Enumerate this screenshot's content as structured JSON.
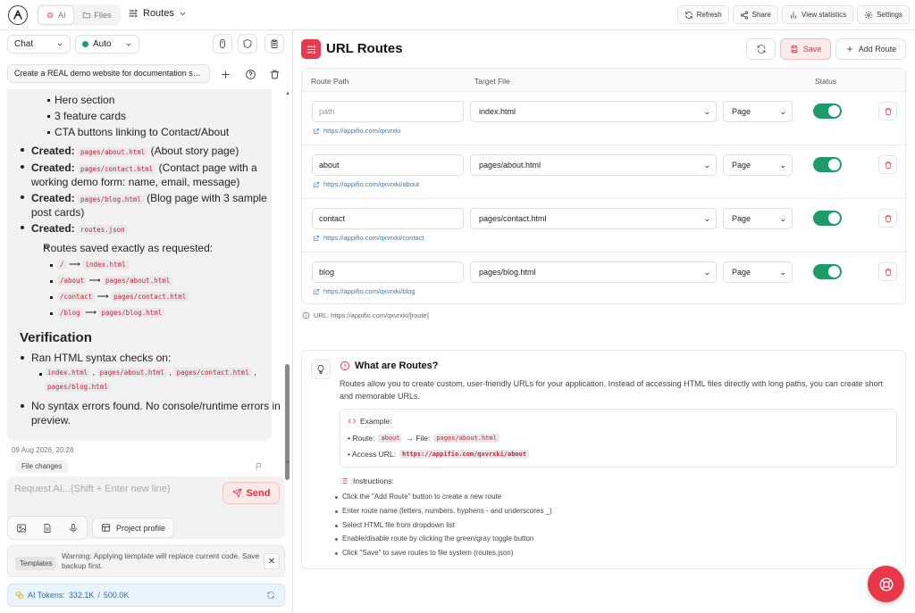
{
  "topbar": {
    "tabs": [
      {
        "label": "AI",
        "icon": "sparkle-icon"
      },
      {
        "label": "Files",
        "icon": "folder-icon"
      }
    ],
    "current": "Routes",
    "actions": [
      {
        "label": "Refresh"
      },
      {
        "label": "Share"
      },
      {
        "label": "View statistics"
      },
      {
        "label": "Settings"
      }
    ]
  },
  "sidebar": {
    "mode": "Chat",
    "model": "Auto",
    "model_status_color": "#1e9b6a",
    "conversation_title": "Create a REAL demo website for documentation sc...",
    "chat": {
      "hero_items": [
        "Hero section",
        "3 feature cards",
        "CTA buttons linking to Contact/About"
      ],
      "created": [
        {
          "label": "Created:",
          "file": "pages/about.html",
          "desc": "(About story page)"
        },
        {
          "label": "Created:",
          "file": "pages/contact.html",
          "desc": "(Contact page with a",
          "desc2": "working demo form: name, email, message)"
        },
        {
          "label": "Created:",
          "file": "pages/blog.html",
          "desc": "(Blog page with 3 sample",
          "desc2": "post cards)"
        },
        {
          "label": "Created:",
          "file": "routes.json"
        }
      ],
      "routes_saved": "Routes saved exactly as requested:",
      "route_map": [
        {
          "path": "/",
          "file": "index.html"
        },
        {
          "path": "/about",
          "file": "pages/about.html"
        },
        {
          "path": "/contact",
          "file": "pages/contact.html"
        },
        {
          "path": "/blog",
          "file": "pages/blog.html"
        }
      ],
      "arrow": "⟶",
      "verification_heading": "Verification",
      "syntax_check": "Ran HTML syntax checks on:",
      "checked_files": [
        "index.html",
        "pages/about.html",
        "pages/contact.html",
        "pages/blog.html"
      ],
      "no_errors_1": "No syntax errors found. No console/runtime errors in",
      "no_errors_2": "preview."
    },
    "timestamp": "09 Aug 2026, 20:28",
    "file_changes": "File changes",
    "input_placeholder": "Request AI...(Shift + Enter new line)",
    "send_label": "Send",
    "project_profile": "Project profile",
    "templates_badge": "Templates",
    "warning": "Warning: Applying template will replace current code. Save backup first.",
    "tokens_label": "AI Tokens:",
    "tokens_used": "332.1K",
    "tokens_sep": "/",
    "tokens_total": "500.0K"
  },
  "main": {
    "title": "URL Routes",
    "save_label": "Save",
    "add_route_label": "Add Route",
    "columns": {
      "path": "Route Path",
      "target": "Target File",
      "status": "Status"
    },
    "routes": [
      {
        "path": "",
        "placeholder": "path",
        "target": "index.html",
        "kind": "Page",
        "url": "https://appifio.com/qxvrxki",
        "enabled": true
      },
      {
        "path": "about",
        "placeholder": "path",
        "target": "pages/about.html",
        "kind": "Page",
        "url": "https://appifio.com/qxvrxki/about",
        "enabled": true
      },
      {
        "path": "contact",
        "placeholder": "path",
        "target": "pages/contact.html",
        "kind": "Page",
        "url": "https://appifio.com/qxvrxki/contact",
        "enabled": true
      },
      {
        "path": "blog",
        "placeholder": "path",
        "target": "pages/blog.html",
        "kind": "Page",
        "url": "https://appifio.com/qxvrxki/blog",
        "enabled": true
      }
    ],
    "url_note": "URL: https://appifio.com/qxvrxki/[route]",
    "info": {
      "title": "What are Routes?",
      "desc": "Routes allow you to create custom, user-friendly URLs for your application. Instead of accessing HTML files directly with long paths, you can create short and memorable URLs.",
      "example_label": "Example:",
      "route_prefix": "• Route:",
      "route_value": "about",
      "file_prefix": "→ File:",
      "file_value": "pages/about.html",
      "access_prefix": "• Access URL:",
      "access_value": "https://appifio.com/qxvrxki/about",
      "instructions_label": "Instructions:",
      "instructions": [
        "Click the \"Add Route\" button to create a new route",
        "Enter route name (letters, numbers, hyphens - and underscores _)",
        "Select HTML file from dropdown list",
        "Enable/disable route by clicking the green/gray toggle button",
        "Click \"Save\" to save routes to file system (routes.json)"
      ]
    }
  },
  "colors": {
    "accent": "#e0303e",
    "toggle_on": "#1e9b6a",
    "link": "#2f7dc4"
  }
}
